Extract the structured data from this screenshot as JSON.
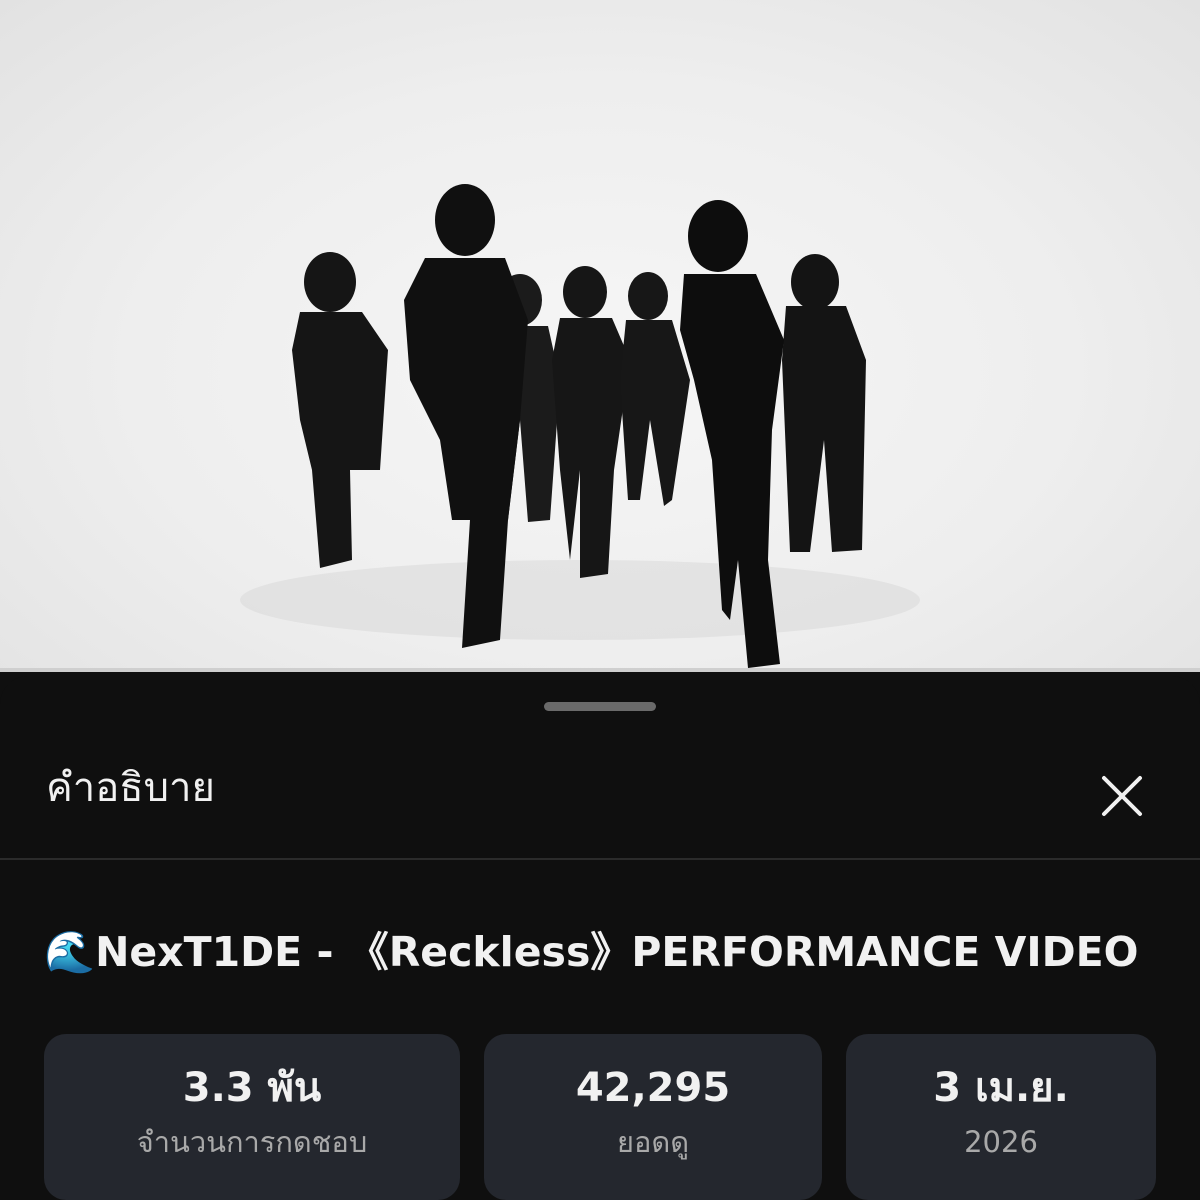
{
  "video": {
    "progress_percent": 0,
    "progress_color": "#ff0033"
  },
  "sheet": {
    "title": "คำอธิบาย",
    "close_icon": "close-icon"
  },
  "video_info": {
    "title_emoji": "🌊",
    "title": "NexT1DE - 《Reckless》PERFORMANCE VIDEO"
  },
  "stats": [
    {
      "value": "3.3 พัน",
      "label": "จำนวนการกดชอบ"
    },
    {
      "value": "42,295",
      "label": "ยอดดู"
    },
    {
      "value": "3 เม.ย.",
      "label": "2026"
    }
  ],
  "colors": {
    "background": "#0f0f0f",
    "card": "#24272e",
    "text_primary": "#f1f1f1",
    "text_secondary": "#a9a9a9"
  }
}
